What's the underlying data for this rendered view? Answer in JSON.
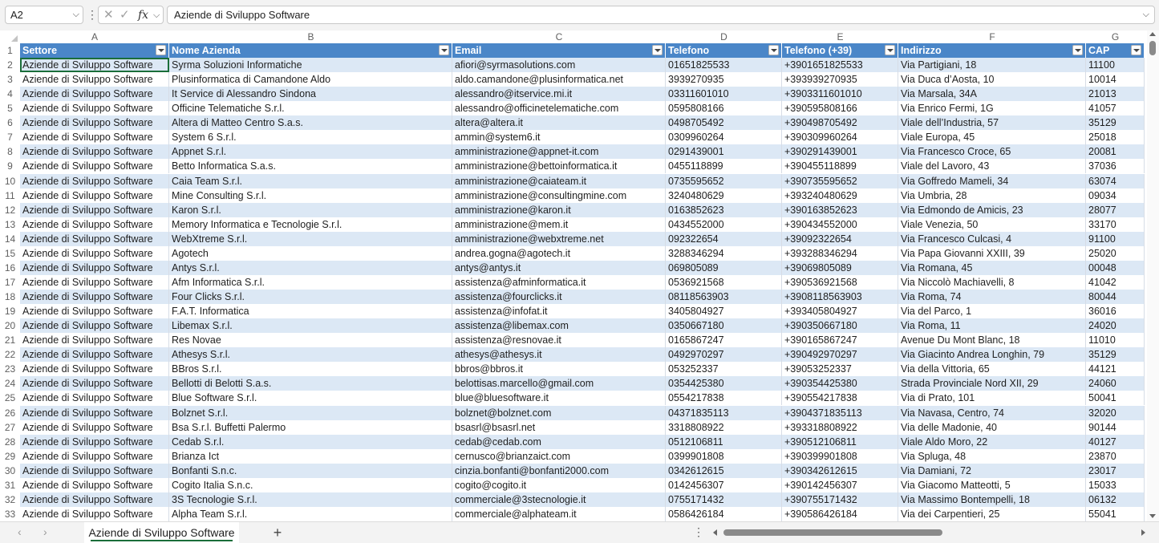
{
  "formula_bar": {
    "name_box": "A2",
    "fx_label": "fx",
    "formula": "Aziende di Sviluppo Software"
  },
  "columns": [
    "A",
    "B",
    "C",
    "D",
    "E",
    "F",
    "G"
  ],
  "header": [
    "Settore",
    "Nome Azienda",
    "Email",
    "Telefono",
    "Telefono (+39)",
    "Indirizzo",
    "CAP"
  ],
  "rows": [
    [
      "Aziende di Sviluppo Software",
      "Syrma Soluzioni Informatiche",
      "afiori@syrmasolutions.com",
      "01651825533",
      "+3901651825533",
      "Via Partigiani, 18",
      "11100"
    ],
    [
      "Aziende di Sviluppo Software",
      "Plusinformatica di Camandone Aldo",
      "aldo.camandone@plusinformatica.net",
      "3939270935",
      "+393939270935",
      "Via Duca d’Aosta, 10",
      "10014"
    ],
    [
      "Aziende di Sviluppo Software",
      "It Service di Alessandro Sindona",
      "alessandro@itservice.mi.it",
      "03311601010",
      "+3903311601010",
      "Via Marsala, 34A",
      "21013"
    ],
    [
      "Aziende di Sviluppo Software",
      "Officine Telematiche S.r.l.",
      "alessandro@officinetelematiche.com",
      "0595808166",
      "+390595808166",
      "Via Enrico Fermi, 1G",
      "41057"
    ],
    [
      "Aziende di Sviluppo Software",
      "Altera di Matteo Centro S.a.s.",
      "altera@altera.it",
      "0498705492",
      "+390498705492",
      "Viale dell’Industria, 57",
      "35129"
    ],
    [
      "Aziende di Sviluppo Software",
      "System 6 S.r.l.",
      "ammin@system6.it",
      "0309960264",
      "+390309960264",
      "Viale Europa, 45",
      "25018"
    ],
    [
      "Aziende di Sviluppo Software",
      "Appnet S.r.l.",
      "amministrazione@appnet-it.com",
      "0291439001",
      "+390291439001",
      "Via Francesco Croce, 65",
      "20081"
    ],
    [
      "Aziende di Sviluppo Software",
      "Betto Informatica S.a.s.",
      "amministrazione@bettoinformatica.it",
      "0455118899",
      "+390455118899",
      "Viale del Lavoro, 43",
      "37036"
    ],
    [
      "Aziende di Sviluppo Software",
      "Caia Team S.r.l.",
      "amministrazione@caiateam.it",
      "0735595652",
      "+390735595652",
      "Via Goffredo Mameli, 34",
      "63074"
    ],
    [
      "Aziende di Sviluppo Software",
      "Mine Consulting S.r.l.",
      "amministrazione@consultingmine.com",
      "3240480629",
      "+393240480629",
      "Via Umbria, 28",
      "09034"
    ],
    [
      "Aziende di Sviluppo Software",
      "Karon S.r.l.",
      "amministrazione@karon.it",
      "0163852623",
      "+390163852623",
      "Via Edmondo de Amicis, 23",
      "28077"
    ],
    [
      "Aziende di Sviluppo Software",
      "Memory Informatica e Tecnologie S.r.l.",
      "amministrazione@mem.it",
      "0434552000",
      "+390434552000",
      "Viale Venezia, 50",
      "33170"
    ],
    [
      "Aziende di Sviluppo Software",
      "WebXtreme S.r.l.",
      "amministrazione@webxtreme.net",
      "092322654",
      "+39092322654",
      "Via Francesco Culcasi, 4",
      "91100"
    ],
    [
      "Aziende di Sviluppo Software",
      "Agotech",
      "andrea.gogna@agotech.it",
      "3288346294",
      "+393288346294",
      "Via Papa Giovanni XXIII, 39",
      "25020"
    ],
    [
      "Aziende di Sviluppo Software",
      "Antys S.r.l.",
      "antys@antys.it",
      "069805089",
      "+39069805089",
      "Via Romana, 45",
      "00048"
    ],
    [
      "Aziende di Sviluppo Software",
      "Afm Informatica S.r.l.",
      "assistenza@afminformatica.it",
      "0536921568",
      "+390536921568",
      "Via Niccolò Machiavelli, 8",
      "41042"
    ],
    [
      "Aziende di Sviluppo Software",
      "Four Clicks S.r.l.",
      "assistenza@fourclicks.it",
      "08118563903",
      "+3908118563903",
      "Via Roma, 74",
      "80044"
    ],
    [
      "Aziende di Sviluppo Software",
      "F.A.T. Informatica",
      "assistenza@infofat.it",
      "3405804927",
      "+393405804927",
      "Via del Parco, 1",
      "36016"
    ],
    [
      "Aziende di Sviluppo Software",
      "Libemax S.r.l.",
      "assistenza@libemax.com",
      "0350667180",
      "+390350667180",
      "Via Roma, 11",
      "24020"
    ],
    [
      "Aziende di Sviluppo Software",
      "Res Novae",
      "assistenza@resnovae.it",
      "0165867247",
      "+390165867247",
      "Avenue Du Mont Blanc, 18",
      "11010"
    ],
    [
      "Aziende di Sviluppo Software",
      "Athesys S.r.l.",
      "athesys@athesys.it",
      "0492970297",
      "+390492970297",
      "Via Giacinto Andrea Longhin, 79",
      "35129"
    ],
    [
      "Aziende di Sviluppo Software",
      "BBros S.r.l.",
      "bbros@bbros.it",
      "053252337",
      "+39053252337",
      "Via della Vittoria, 65",
      "44121"
    ],
    [
      "Aziende di Sviluppo Software",
      "Bellotti di Belotti S.a.s.",
      "belottisas.marcello@gmail.com",
      "0354425380",
      "+390354425380",
      "Strada Provinciale Nord XII, 29",
      "24060"
    ],
    [
      "Aziende di Sviluppo Software",
      "Blue Software S.r.l.",
      "blue@bluesoftware.it",
      "0554217838",
      "+390554217838",
      "Via di Prato, 101",
      "50041"
    ],
    [
      "Aziende di Sviluppo Software",
      "Bolznet S.r.l.",
      "bolznet@bolznet.com",
      "04371835113",
      "+3904371835113",
      "Via Navasa, Centro, 74",
      "32020"
    ],
    [
      "Aziende di Sviluppo Software",
      "Bsa S.r.l. Buffetti Palermo",
      "bsasrl@bsasrl.net",
      "3318808922",
      "+393318808922",
      "Via delle Madonie, 40",
      "90144"
    ],
    [
      "Aziende di Sviluppo Software",
      "Cedab S.r.l.",
      "cedab@cedab.com",
      "0512106811",
      "+390512106811",
      "Viale Aldo Moro, 22",
      "40127"
    ],
    [
      "Aziende di Sviluppo Software",
      "Brianza Ict",
      "cernusco@brianzaict.com",
      "0399901808",
      "+390399901808",
      "Via Spluga, 48",
      "23870"
    ],
    [
      "Aziende di Sviluppo Software",
      "Bonfanti S.n.c.",
      "cinzia.bonfanti@bonfanti2000.com",
      "0342612615",
      "+390342612615",
      "Via Damiani, 72",
      "23017"
    ],
    [
      "Aziende di Sviluppo Software",
      "Cogito Italia S.n.c.",
      "cogito@cogito.it",
      "0142456307",
      "+390142456307",
      "Via Giacomo Matteotti, 5",
      "15033"
    ],
    [
      "Aziende di Sviluppo Software",
      "3S Tecnologie S.r.l.",
      "commerciale@3stecnologie.it",
      "0755171432",
      "+390755171432",
      "Via Massimo Bontempelli, 18",
      "06132"
    ],
    [
      "Aziende di Sviluppo Software",
      "Alpha Team S.r.l.",
      "commerciale@alphateam.it",
      "0586426184",
      "+390586426184",
      "Via dei Carpentieri, 25",
      "55041"
    ]
  ],
  "sheet_tabs": [
    "Aziende di Sviluppo Software"
  ],
  "colors": {
    "header_fill": "#4a86c8",
    "band_fill": "#dce8f5",
    "active_tab_accent": "#1a6e3a"
  }
}
